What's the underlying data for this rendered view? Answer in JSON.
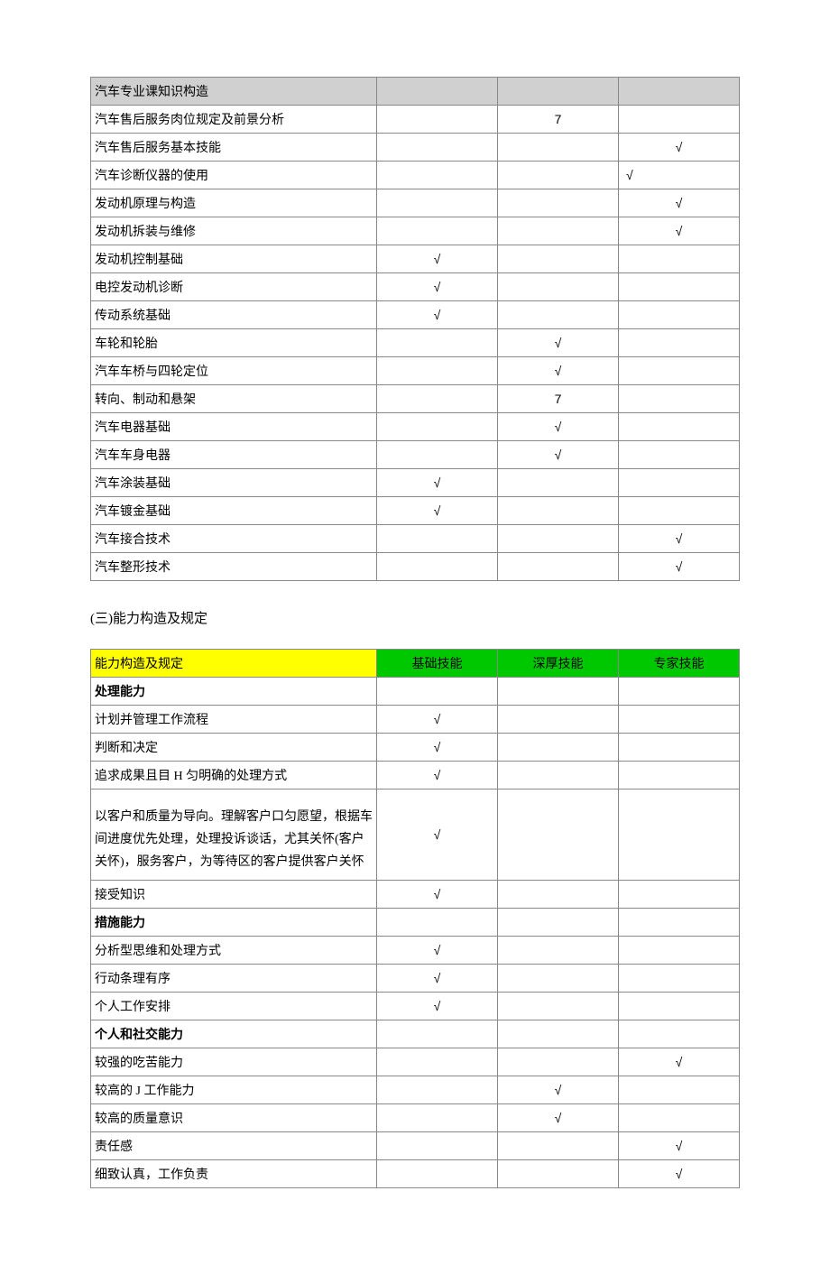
{
  "table1": {
    "header": "汽车专业课知识构造",
    "rows": [
      {
        "label": "汽车售后服务肉位规定及前景分析",
        "c1": "",
        "c2": "7",
        "c3": ""
      },
      {
        "label": "汽车售后服务基本技能",
        "c1": "",
        "c2": "",
        "c3": "√"
      },
      {
        "label": "汽车诊断仪器的使用",
        "c1": "",
        "c2": "",
        "c3": "√",
        "c3align": "left"
      },
      {
        "label": "发动机原理与构造",
        "c1": "",
        "c2": "",
        "c3": "√"
      },
      {
        "label": "发动机拆装与维修",
        "c1": "",
        "c2": "",
        "c3": "√"
      },
      {
        "label": "发动机控制基础",
        "c1": "√",
        "c2": "",
        "c3": ""
      },
      {
        "label": "电控发动机诊断",
        "c1": "√",
        "c2": "",
        "c3": ""
      },
      {
        "label": "传动系统基础",
        "c1": "√",
        "c2": "",
        "c3": ""
      },
      {
        "label": "车轮和轮胎",
        "c1": "",
        "c2": "√",
        "c3": ""
      },
      {
        "label": "汽车车桥与四轮定位",
        "c1": "",
        "c2": "√",
        "c3": ""
      },
      {
        "label": "转向、制动和悬架",
        "c1": "",
        "c2": "7",
        "c3": ""
      },
      {
        "label": "汽车电器基础",
        "c1": "",
        "c2": "√",
        "c3": ""
      },
      {
        "label": "汽车车身电器",
        "c1": "",
        "c2": "√",
        "c3": ""
      },
      {
        "label": "汽车涂装基础",
        "c1": "√",
        "c2": "",
        "c3": ""
      },
      {
        "label": "汽车镀金基础",
        "c1": "√",
        "c2": "",
        "c3": ""
      },
      {
        "label": "汽车接合技术",
        "c1": "",
        "c2": "",
        "c3": "√"
      },
      {
        "label": "汽车整形技术",
        "c1": "",
        "c2": "",
        "c3": "√"
      }
    ]
  },
  "section_heading": "(三)能力构造及规定",
  "table2": {
    "header_label": "能力构造及规定",
    "header_c1": "基础技能",
    "header_c2": "深厚技能",
    "header_c3": "专家技能",
    "rows": [
      {
        "label": "处理能力",
        "bold": true,
        "c1": "",
        "c2": "",
        "c3": ""
      },
      {
        "label": "计划并管理工作流程",
        "c1": "√",
        "c2": "",
        "c3": ""
      },
      {
        "label": "判断和决定",
        "c1": "√",
        "c2": "",
        "c3": ""
      },
      {
        "label": "追求成果且目 H 匀明确的处理方式",
        "c1": "√",
        "c2": "",
        "c3": ""
      },
      {
        "label": "以客户和质量为导向。理解客户口匀愿望，根据车间进度优先处理，处理投诉谈话，尤其关怀(客户关怀)，服务客户，为等待区的客户提供客户关怀",
        "c1": "√",
        "c2": "",
        "c3": "",
        "tall": true
      },
      {
        "label": "接受知识",
        "c1": "√",
        "c2": "",
        "c3": ""
      },
      {
        "label": "措施能力",
        "bold": true,
        "c1": "",
        "c2": "",
        "c3": ""
      },
      {
        "label": "分析型思维和处理方式",
        "c1": "√",
        "c2": "",
        "c3": ""
      },
      {
        "label": "行动条理有序",
        "c1": "√",
        "c2": "",
        "c3": ""
      },
      {
        "label": "个人工作安排",
        "c1": "√",
        "c2": "",
        "c3": ""
      },
      {
        "label": "个人和社交能力",
        "bold": true,
        "c1": "",
        "c2": "",
        "c3": ""
      },
      {
        "label": "较强的吃苦能力",
        "c1": "",
        "c2": "",
        "c3": "√"
      },
      {
        "label": "较高的 J 工作能力",
        "c1": "",
        "c2": "√",
        "c3": ""
      },
      {
        "label": "较高的质量意识",
        "c1": "",
        "c2": "√",
        "c3": ""
      },
      {
        "label": "责任感",
        "c1": "",
        "c2": "",
        "c3": "√"
      },
      {
        "label": "细致认真，工作负责",
        "c1": "",
        "c2": "",
        "c3": "√"
      }
    ]
  }
}
